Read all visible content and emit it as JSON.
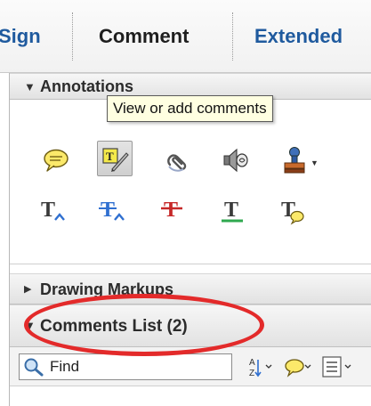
{
  "tabs": [
    {
      "label": "Sign"
    },
    {
      "label": "Comment"
    },
    {
      "label": "Extended"
    }
  ],
  "annotations": {
    "title": "Annotations",
    "tooltip": "View or add comments",
    "tools_row1": [
      "sticky-note-icon",
      "highlight-text-icon",
      "attach-file-icon",
      "record-audio-icon",
      "stamp-icon"
    ],
    "tools_row2": [
      "insert-text-icon",
      "replace-text-icon",
      "strikethrough-icon",
      "underline-icon",
      "text-comment-icon"
    ]
  },
  "drawing_markups": {
    "title": "Drawing Markups"
  },
  "comments_list": {
    "title": "Comments List (2)",
    "find_label": "Find"
  },
  "colors": {
    "tab_blue": "#1f5a9e",
    "sticky_yellow": "#fbe96a",
    "highlight_red": "#e32a2a",
    "underline_green": "#2fa84f"
  }
}
